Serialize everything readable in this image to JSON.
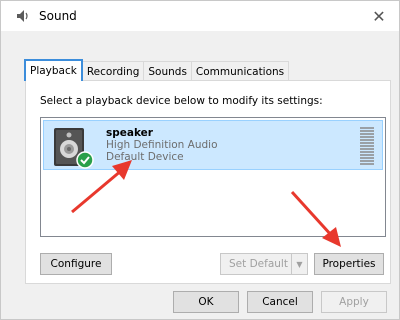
{
  "window": {
    "title": "Sound",
    "close_symbol": "✕"
  },
  "tabs": [
    {
      "label": "Playback",
      "active": true
    },
    {
      "label": "Recording",
      "active": false
    },
    {
      "label": "Sounds",
      "active": false
    },
    {
      "label": "Communications",
      "active": false
    }
  ],
  "panel": {
    "instruction": "Select a playback device below to modify its settings:"
  },
  "device": {
    "name": "speaker",
    "description": "High Definition Audio",
    "status": "Default Device",
    "icon": "speaker-icon",
    "status_icon": "check-icon"
  },
  "buttons": {
    "configure": "Configure",
    "set_default": "Set Default",
    "set_default_arrow": "▼",
    "properties": "Properties",
    "ok": "OK",
    "cancel": "Cancel",
    "apply": "Apply"
  },
  "colors": {
    "selection": "#cce8ff",
    "tab_active_border": "#3c8ddb",
    "annotation_arrow": "#e8382d",
    "check_green": "#2aa04a"
  }
}
